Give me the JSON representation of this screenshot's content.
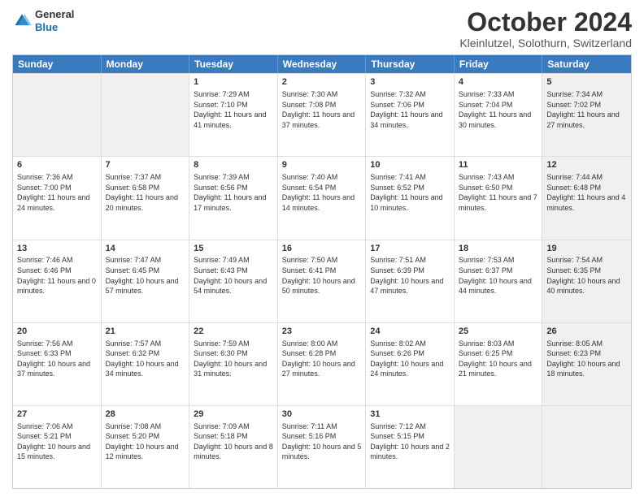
{
  "header": {
    "logo_general": "General",
    "logo_blue": "Blue",
    "month_title": "October 2024",
    "subtitle": "Kleinlutzel, Solothurn, Switzerland"
  },
  "weekdays": [
    "Sunday",
    "Monday",
    "Tuesday",
    "Wednesday",
    "Thursday",
    "Friday",
    "Saturday"
  ],
  "rows": [
    [
      {
        "day": "",
        "info": "",
        "shaded": true
      },
      {
        "day": "",
        "info": "",
        "shaded": true
      },
      {
        "day": "1",
        "info": "Sunrise: 7:29 AM\nSunset: 7:10 PM\nDaylight: 11 hours and 41 minutes."
      },
      {
        "day": "2",
        "info": "Sunrise: 7:30 AM\nSunset: 7:08 PM\nDaylight: 11 hours and 37 minutes."
      },
      {
        "day": "3",
        "info": "Sunrise: 7:32 AM\nSunset: 7:06 PM\nDaylight: 11 hours and 34 minutes."
      },
      {
        "day": "4",
        "info": "Sunrise: 7:33 AM\nSunset: 7:04 PM\nDaylight: 11 hours and 30 minutes."
      },
      {
        "day": "5",
        "info": "Sunrise: 7:34 AM\nSunset: 7:02 PM\nDaylight: 11 hours and 27 minutes.",
        "shaded": true
      }
    ],
    [
      {
        "day": "6",
        "info": "Sunrise: 7:36 AM\nSunset: 7:00 PM\nDaylight: 11 hours and 24 minutes."
      },
      {
        "day": "7",
        "info": "Sunrise: 7:37 AM\nSunset: 6:58 PM\nDaylight: 11 hours and 20 minutes."
      },
      {
        "day": "8",
        "info": "Sunrise: 7:39 AM\nSunset: 6:56 PM\nDaylight: 11 hours and 17 minutes."
      },
      {
        "day": "9",
        "info": "Sunrise: 7:40 AM\nSunset: 6:54 PM\nDaylight: 11 hours and 14 minutes."
      },
      {
        "day": "10",
        "info": "Sunrise: 7:41 AM\nSunset: 6:52 PM\nDaylight: 11 hours and 10 minutes."
      },
      {
        "day": "11",
        "info": "Sunrise: 7:43 AM\nSunset: 6:50 PM\nDaylight: 11 hours and 7 minutes."
      },
      {
        "day": "12",
        "info": "Sunrise: 7:44 AM\nSunset: 6:48 PM\nDaylight: 11 hours and 4 minutes.",
        "shaded": true
      }
    ],
    [
      {
        "day": "13",
        "info": "Sunrise: 7:46 AM\nSunset: 6:46 PM\nDaylight: 11 hours and 0 minutes."
      },
      {
        "day": "14",
        "info": "Sunrise: 7:47 AM\nSunset: 6:45 PM\nDaylight: 10 hours and 57 minutes."
      },
      {
        "day": "15",
        "info": "Sunrise: 7:49 AM\nSunset: 6:43 PM\nDaylight: 10 hours and 54 minutes."
      },
      {
        "day": "16",
        "info": "Sunrise: 7:50 AM\nSunset: 6:41 PM\nDaylight: 10 hours and 50 minutes."
      },
      {
        "day": "17",
        "info": "Sunrise: 7:51 AM\nSunset: 6:39 PM\nDaylight: 10 hours and 47 minutes."
      },
      {
        "day": "18",
        "info": "Sunrise: 7:53 AM\nSunset: 6:37 PM\nDaylight: 10 hours and 44 minutes."
      },
      {
        "day": "19",
        "info": "Sunrise: 7:54 AM\nSunset: 6:35 PM\nDaylight: 10 hours and 40 minutes.",
        "shaded": true
      }
    ],
    [
      {
        "day": "20",
        "info": "Sunrise: 7:56 AM\nSunset: 6:33 PM\nDaylight: 10 hours and 37 minutes."
      },
      {
        "day": "21",
        "info": "Sunrise: 7:57 AM\nSunset: 6:32 PM\nDaylight: 10 hours and 34 minutes."
      },
      {
        "day": "22",
        "info": "Sunrise: 7:59 AM\nSunset: 6:30 PM\nDaylight: 10 hours and 31 minutes."
      },
      {
        "day": "23",
        "info": "Sunrise: 8:00 AM\nSunset: 6:28 PM\nDaylight: 10 hours and 27 minutes."
      },
      {
        "day": "24",
        "info": "Sunrise: 8:02 AM\nSunset: 6:26 PM\nDaylight: 10 hours and 24 minutes."
      },
      {
        "day": "25",
        "info": "Sunrise: 8:03 AM\nSunset: 6:25 PM\nDaylight: 10 hours and 21 minutes."
      },
      {
        "day": "26",
        "info": "Sunrise: 8:05 AM\nSunset: 6:23 PM\nDaylight: 10 hours and 18 minutes.",
        "shaded": true
      }
    ],
    [
      {
        "day": "27",
        "info": "Sunrise: 7:06 AM\nSunset: 5:21 PM\nDaylight: 10 hours and 15 minutes."
      },
      {
        "day": "28",
        "info": "Sunrise: 7:08 AM\nSunset: 5:20 PM\nDaylight: 10 hours and 12 minutes."
      },
      {
        "day": "29",
        "info": "Sunrise: 7:09 AM\nSunset: 5:18 PM\nDaylight: 10 hours and 8 minutes."
      },
      {
        "day": "30",
        "info": "Sunrise: 7:11 AM\nSunset: 5:16 PM\nDaylight: 10 hours and 5 minutes."
      },
      {
        "day": "31",
        "info": "Sunrise: 7:12 AM\nSunset: 5:15 PM\nDaylight: 10 hours and 2 minutes."
      },
      {
        "day": "",
        "info": "",
        "shaded": true
      },
      {
        "day": "",
        "info": "",
        "shaded": true
      }
    ]
  ]
}
